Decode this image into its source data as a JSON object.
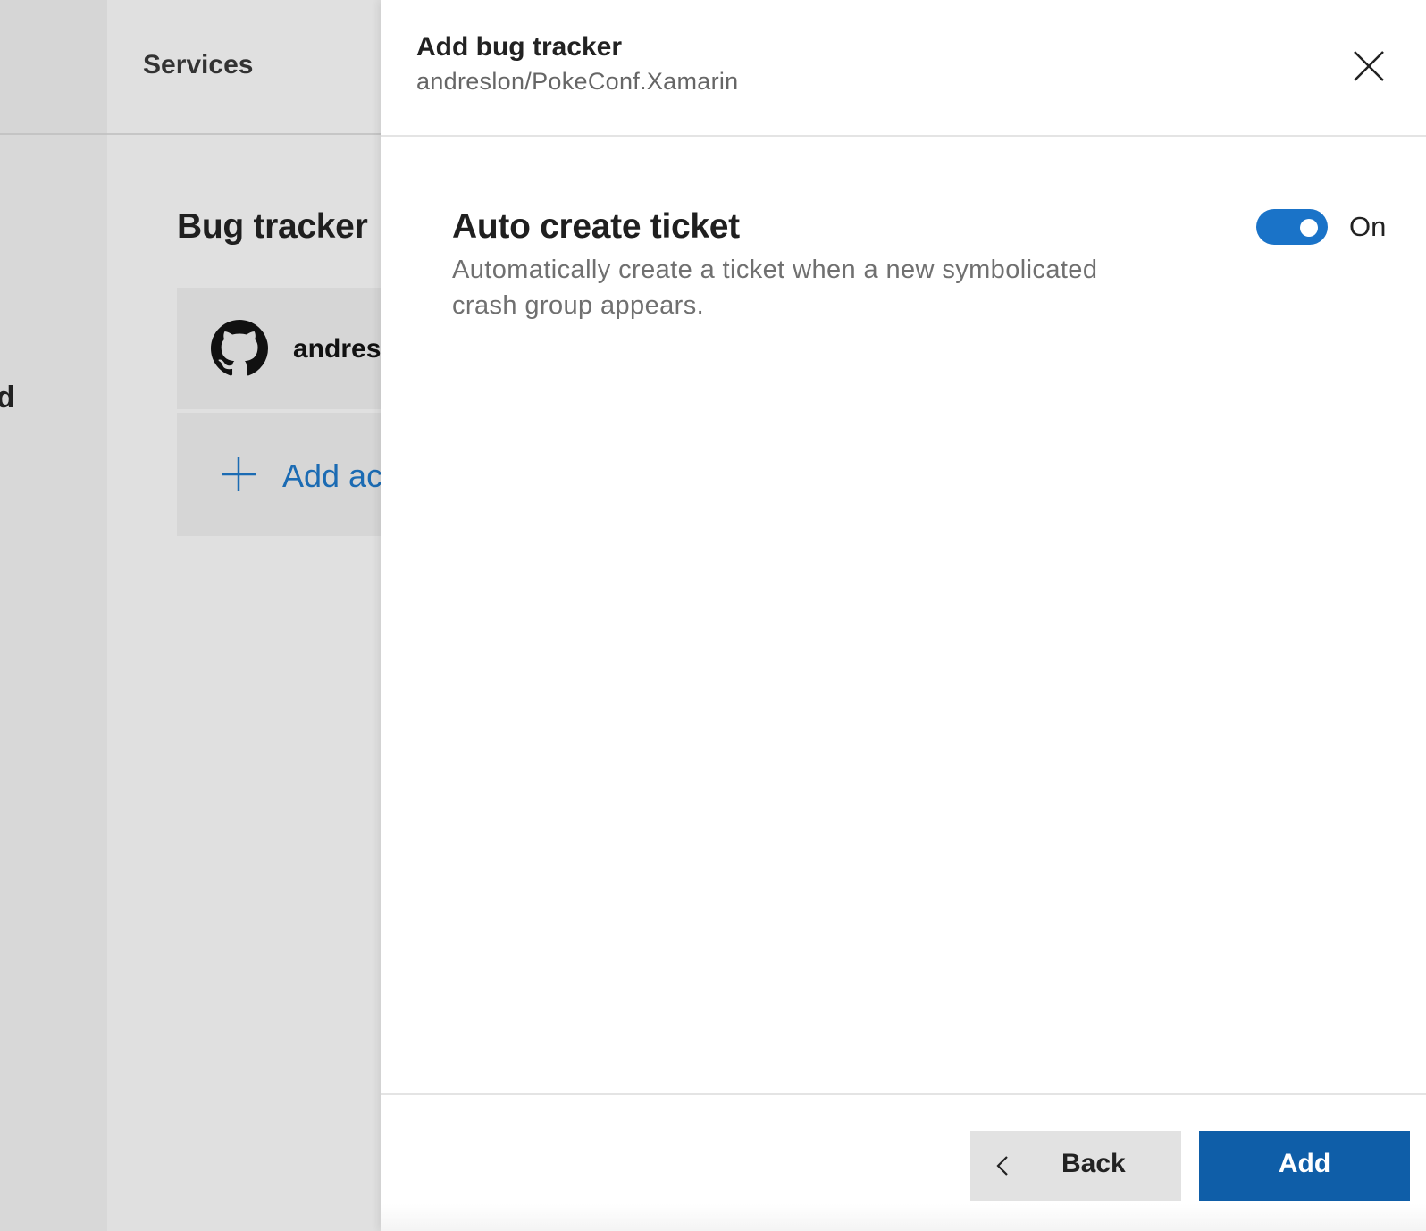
{
  "background": {
    "left_column_partial_text": "id",
    "header_label": "Services",
    "section_heading": "Bug tracker",
    "account_card": {
      "icon": "github-icon",
      "name_truncated": "andres"
    },
    "add_account": {
      "icon": "plus-icon",
      "label_truncated": "Add ac"
    }
  },
  "panel": {
    "title": "Add bug tracker",
    "subtitle": "andreslon/PokeConf.Xamarin",
    "close_icon": "close-icon",
    "setting": {
      "title": "Auto create ticket",
      "description": "Automatically create a ticket when a new symbolicated crash group appears.",
      "toggle_state": "On",
      "toggle_on": true
    },
    "footer": {
      "back_label": "Back",
      "add_label": "Add"
    }
  },
  "colors": {
    "accent": "#1a73c8",
    "primary_button": "#0f5ea8",
    "link": "#1b6bb3"
  }
}
